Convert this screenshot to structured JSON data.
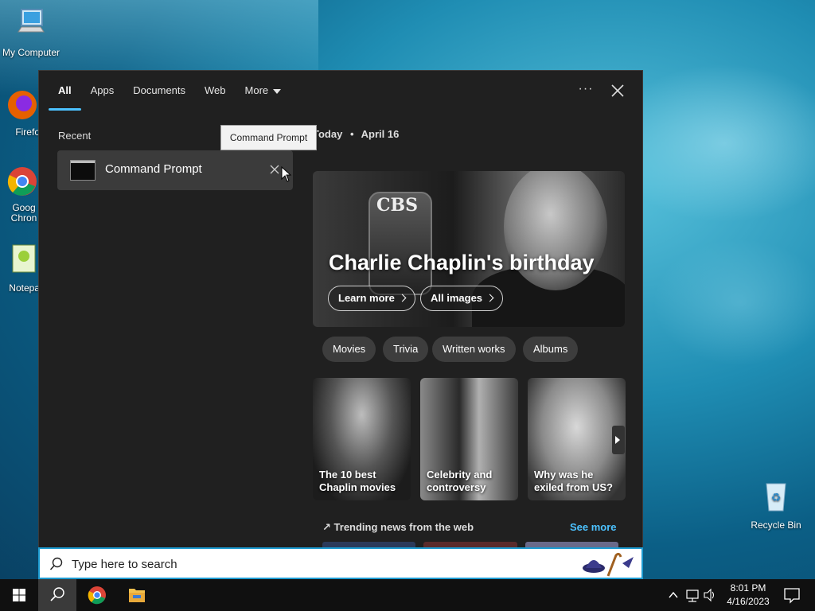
{
  "desktop": {
    "icons": [
      {
        "label": "My Computer"
      },
      {
        "label": "Firefo"
      },
      {
        "label": "Goog Chron"
      },
      {
        "label": "Notepa"
      },
      {
        "label": "Recycle Bin"
      }
    ]
  },
  "search_panel": {
    "tabs": [
      {
        "label": "All",
        "active": true
      },
      {
        "label": "Apps"
      },
      {
        "label": "Documents"
      },
      {
        "label": "Web"
      },
      {
        "label": "More"
      }
    ],
    "more_options_label": "···",
    "recent": {
      "heading": "Recent",
      "items": [
        {
          "label": "Command Prompt"
        }
      ]
    },
    "tooltip": "Command Prompt",
    "today": {
      "prefix": "Today",
      "separator": "•",
      "date": "April 16"
    },
    "hero": {
      "title": "Charlie Chaplin's birthday",
      "mic_text": "CBS",
      "buttons": [
        "Learn more",
        "All images"
      ]
    },
    "chips": [
      "Movies",
      "Trivia",
      "Written works",
      "Albums"
    ],
    "cards": [
      {
        "caption": "The 10 best Chaplin movies"
      },
      {
        "caption": "Celebrity and controversy"
      },
      {
        "caption": "Why was he exiled from US?"
      }
    ],
    "trending": {
      "label": "Trending news from the web",
      "see_more": "See more"
    }
  },
  "search_box": {
    "placeholder": "Type here to search"
  },
  "taskbar": {
    "clock": {
      "time": "8:01 PM",
      "date": "4/16/2023"
    }
  },
  "colors": {
    "accent": "#4cc2ff",
    "panel_bg": "#202020",
    "search_border": "#1d9bd1"
  }
}
